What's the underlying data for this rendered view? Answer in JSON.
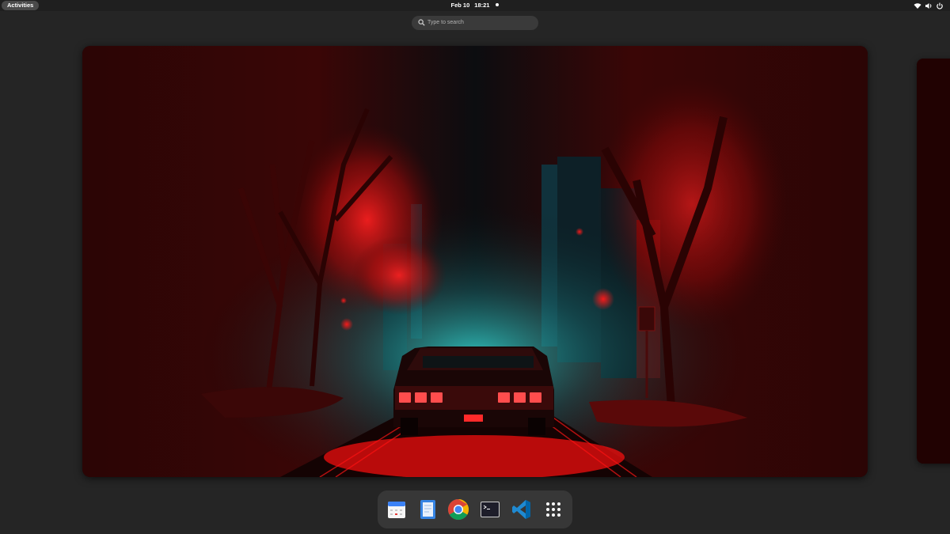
{
  "topbar": {
    "activities_label": "Activities",
    "date": "Feb 10",
    "time": "18:21",
    "system_icons": [
      "wifi-icon",
      "volume-icon",
      "power-icon"
    ]
  },
  "search": {
    "placeholder": "Type to search"
  },
  "workspace": {
    "wallpaper": "red-lit car on a road between trees and city towers",
    "colors": {
      "accent_red": "#ff1a1a",
      "teal_glow": "#35d5d0"
    }
  },
  "dash": {
    "apps": [
      {
        "name": "Calendar",
        "icon": "calendar-icon"
      },
      {
        "name": "Text Editor",
        "icon": "text-editor-icon"
      },
      {
        "name": "Google Chrome",
        "icon": "chrome-icon"
      },
      {
        "name": "Terminal",
        "icon": "terminal-icon"
      },
      {
        "name": "Visual Studio Code",
        "icon": "vscode-icon"
      },
      {
        "name": "Show Apps",
        "icon": "app-grid-icon"
      }
    ]
  }
}
